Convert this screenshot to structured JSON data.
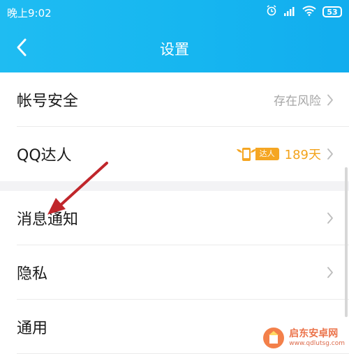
{
  "status_bar": {
    "time": "晚上9:02",
    "battery": "53"
  },
  "nav": {
    "title": "设置",
    "back_icon": "chevron-left-icon"
  },
  "rows": [
    {
      "label": "帐号安全",
      "status": "存在风险"
    },
    {
      "label": "QQ达人",
      "badge": "达人",
      "days": "189天"
    },
    {
      "label": "消息通知"
    },
    {
      "label": "隐私"
    },
    {
      "label": "通用"
    }
  ],
  "watermark": {
    "name": "启东安卓网",
    "url": "www.qdlutsg.com"
  },
  "colors": {
    "header": "#16b6f0",
    "accent_orange": "#f3a31b",
    "annotation_arrow": "#c0262b"
  }
}
